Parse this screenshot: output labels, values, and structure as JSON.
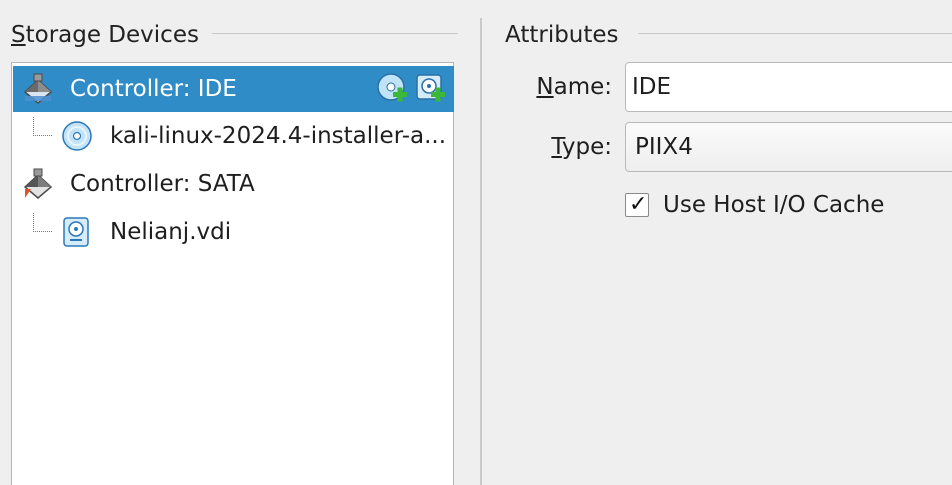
{
  "storage": {
    "title_mnemonic": "S",
    "title_rest": "torage Devices",
    "items": [
      {
        "label": "Controller: IDE",
        "icon": "ide-controller-icon",
        "selected": true
      },
      {
        "label": "kali-linux-2024.4-installer-a...",
        "icon": "optical-disc-icon"
      },
      {
        "label": "Controller: SATA",
        "icon": "sata-controller-icon"
      },
      {
        "label": "Nelianj.vdi",
        "icon": "hard-disk-icon"
      }
    ],
    "buttons": {
      "add_optical": "add-optical-drive-icon",
      "add_hard_disk": "add-hard-disk-icon"
    }
  },
  "attributes": {
    "title": "Attributes",
    "name_mnemonic": "N",
    "name_rest": "ame:",
    "name_value": "IDE",
    "type_mnemonic": "T",
    "type_rest": "ype:",
    "type_value": "PIIX4",
    "host_cache_label": "Use Host I/O Cache",
    "host_cache_checked": true,
    "checkmark": "✓"
  },
  "colors": {
    "selection": "#308cc6",
    "background": "#efefef",
    "add_green": "#3cb838"
  }
}
